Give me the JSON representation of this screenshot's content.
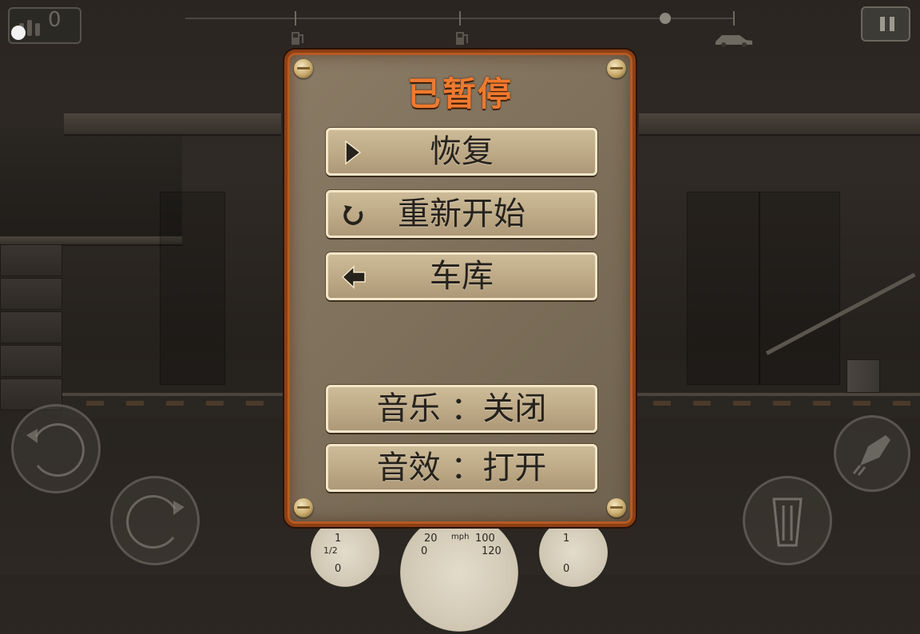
{
  "hud": {
    "ammo_count": "0",
    "progress": 0.87
  },
  "pause_menu": {
    "title": "已暂停",
    "resume_label": "恢复",
    "restart_label": "重新开始",
    "garage_label": "车库",
    "music_label": "音乐 ：关闭",
    "sfx_label": "音效 ：打开"
  },
  "gauges": {
    "left_dial_top": "1",
    "left_dial_half": "1/2",
    "left_dial_bottom": "0",
    "speed_unit": "mph",
    "speed_ticks": [
      "20",
      "100",
      "0",
      "120"
    ],
    "right_dial_top": "1",
    "right_dial_bottom": "0"
  },
  "colors": {
    "title": "#ee7a2e",
    "panel_border": "#8c3f15",
    "button_face": "#c3b08e"
  },
  "icons": {
    "resume": "play-triangle-icon",
    "restart": "circular-arrow-icon",
    "garage": "left-arrow-icon",
    "pause": "pause-icon",
    "boost": "rocket-icon",
    "brake": "trash-can-pedal-icon"
  }
}
